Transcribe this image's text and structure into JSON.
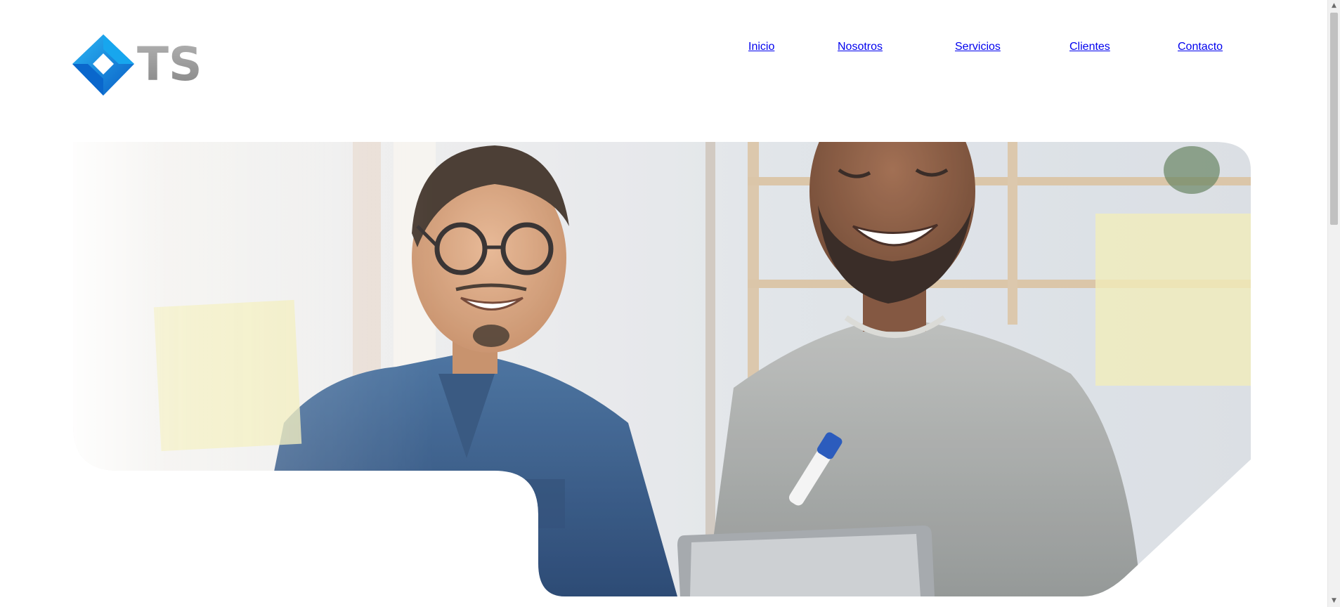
{
  "logo": {
    "letters": "TS",
    "icon": "blue-diamond-logo-icon"
  },
  "nav": {
    "items": [
      {
        "label": "Inicio"
      },
      {
        "label": "Nosotros"
      },
      {
        "label": "Servicios"
      },
      {
        "label": "Clientes"
      },
      {
        "label": "Contacto"
      }
    ]
  },
  "hero": {
    "image": "two-men-smiling-collaborating-behind-glass-photo"
  },
  "colors": {
    "brand_blue": "#1ea0e6",
    "brand_blue_dark": "#0a5cc4",
    "logo_gray": "#9a9a9a",
    "nav_text": "#1a1a1a",
    "background": "#ffffff"
  },
  "scrollbar": {
    "up_icon": "chevron-up-icon",
    "down_icon": "chevron-down-icon"
  }
}
